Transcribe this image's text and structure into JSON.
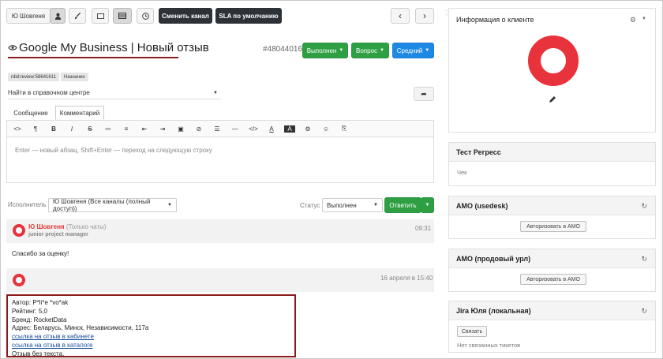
{
  "toolbar": {
    "user_name": "Ю Шовгеня",
    "change_channel": "Сменить канал",
    "sla_default": "SLA по умолчанию",
    "prev": "‹",
    "next": "›"
  },
  "ticket": {
    "title": "Google My Business | Новый отзыв",
    "id": "#48044016",
    "status_btn": "Выполнен",
    "type_btn": "Вопрос",
    "priority_btn": "Средний",
    "tags": [
      "rdid:review:58641611",
      "Назначен"
    ],
    "help_center_select": "Найти в справочном центре"
  },
  "composer": {
    "tab_message": "Сообщение",
    "tab_comment": "Комментарий",
    "placeholder": "Enter — новый абзац, Shift+Enter — переход на следующую строку",
    "toolbar_icons": [
      "<>",
      "¶",
      "B",
      "I",
      "S",
      "≔",
      "≡",
      "⇤",
      "⇥",
      "▣",
      "⊘",
      "☰",
      "—",
      "</>",
      "A",
      "A",
      "⚙",
      "☺",
      "⎘"
    ]
  },
  "assign": {
    "executor_label": "Исполнитель",
    "executor_value": "Ю Шовгеня (Все каналы (полный доступ))",
    "status_label": "Статус",
    "status_value": "Выполнен",
    "reply_btn": "Ответить"
  },
  "messages": [
    {
      "author": "Ю Шовгеня",
      "note": "(Только чаты)",
      "role": "junior project manager",
      "time": "09:31",
      "body": "Спасибо за оценку!"
    },
    {
      "time": "16 апреля в 15:40",
      "review": {
        "author": "Автор: P*li*e *vo*ak",
        "rating": "Рейтинг: 5,0",
        "brand": "Бренд: RocketData",
        "address": "Адрес: Беларусь, Минск, Независимости, 117а",
        "link_cabinet": "ссылка на отзыв в кабинете",
        "link_catalog": "ссылка на отзыв в каталоге",
        "no_text": "Отзыв без текста."
      }
    }
  ],
  "sidebar": {
    "client_info": "Информация о клиенте",
    "test_regress": "Тест Регресс",
    "check": "Чек",
    "amo_usedesk": "АМО (usedesk)",
    "amo_prod": "АМО (продовый урл)",
    "authorize_amo": "Авторизовать в АМО",
    "jira": "Jira Юля (локальная)",
    "link_btn": "Связать",
    "no_tickets": "Нет связанных тикетов"
  },
  "colors": {
    "accent_red": "#e8323c",
    "green": "#2ea043",
    "blue": "#1e88e5",
    "dark": "#2d3138",
    "highlight": "#8b1b1b"
  }
}
